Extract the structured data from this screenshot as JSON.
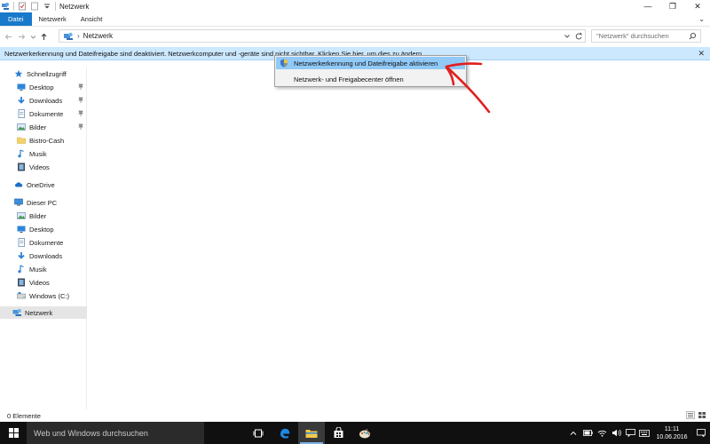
{
  "window": {
    "title": "Netzwerk",
    "controls": {
      "minimize": "—",
      "maximize": "❐",
      "close": "✕"
    }
  },
  "ribbon": {
    "tabs": [
      {
        "label": "Datei"
      },
      {
        "label": "Netzwerk"
      },
      {
        "label": "Ansicht"
      }
    ],
    "expand_glyph": "⌄"
  },
  "address": {
    "path": "Netzwerk",
    "separator": "›",
    "search_placeholder": "\"Netzwerk\" durchsuchen"
  },
  "infobar": {
    "text": "Netzwerkerkennung und Dateifreigabe sind deaktiviert. Netzwerkcomputer und -geräte sind nicht sichtbar. Klicken Sie hier, um dies zu ändern.",
    "close": "✕"
  },
  "context_menu": {
    "items": [
      {
        "label": "Netzwerkerkennung und Dateifreigabe aktivieren",
        "icon": "shield-icon",
        "highlighted": true
      },
      {
        "label": "Netzwerk- und Freigabecenter öffnen",
        "highlighted": false
      }
    ]
  },
  "navigation": {
    "quick_access": {
      "label": "Schnellzugriff",
      "items": [
        {
          "label": "Desktop",
          "icon": "desktop-icon",
          "pinned": true
        },
        {
          "label": "Downloads",
          "icon": "download-icon",
          "pinned": true
        },
        {
          "label": "Dokumente",
          "icon": "documents-icon",
          "pinned": true
        },
        {
          "label": "Bilder",
          "icon": "pictures-icon",
          "pinned": true
        },
        {
          "label": "Bistro-Cash",
          "icon": "folder-icon",
          "pinned": false
        },
        {
          "label": "Musik",
          "icon": "music-icon",
          "pinned": false
        },
        {
          "label": "Videos",
          "icon": "videos-icon",
          "pinned": false
        }
      ]
    },
    "onedrive": {
      "label": "OneDrive"
    },
    "this_pc": {
      "label": "Dieser PC",
      "items": [
        {
          "label": "Bilder",
          "icon": "pictures-icon"
        },
        {
          "label": "Desktop",
          "icon": "desktop-icon"
        },
        {
          "label": "Dokumente",
          "icon": "documents-icon"
        },
        {
          "label": "Downloads",
          "icon": "download-icon"
        },
        {
          "label": "Musik",
          "icon": "music-icon"
        },
        {
          "label": "Videos",
          "icon": "videos-icon"
        },
        {
          "label": "Windows (C:)",
          "icon": "drive-icon"
        }
      ]
    },
    "network": {
      "label": "Netzwerk",
      "selected": true
    }
  },
  "status": {
    "item_count": "0 Elemente"
  },
  "taskbar": {
    "search_placeholder": "Web und Windows durchsuchen",
    "apps": [
      "task-view-icon",
      "edge-icon",
      "file-explorer-icon",
      "store-icon",
      "paint-icon"
    ],
    "clock": {
      "time": "11:11",
      "date": "10.06.2016"
    }
  },
  "colors": {
    "accent": "#1979ca",
    "infobar_bg": "#cce8ff",
    "menu_highlight": "#91c9f7",
    "annotation": "#e0201e",
    "taskbar_bg": "#101010"
  }
}
